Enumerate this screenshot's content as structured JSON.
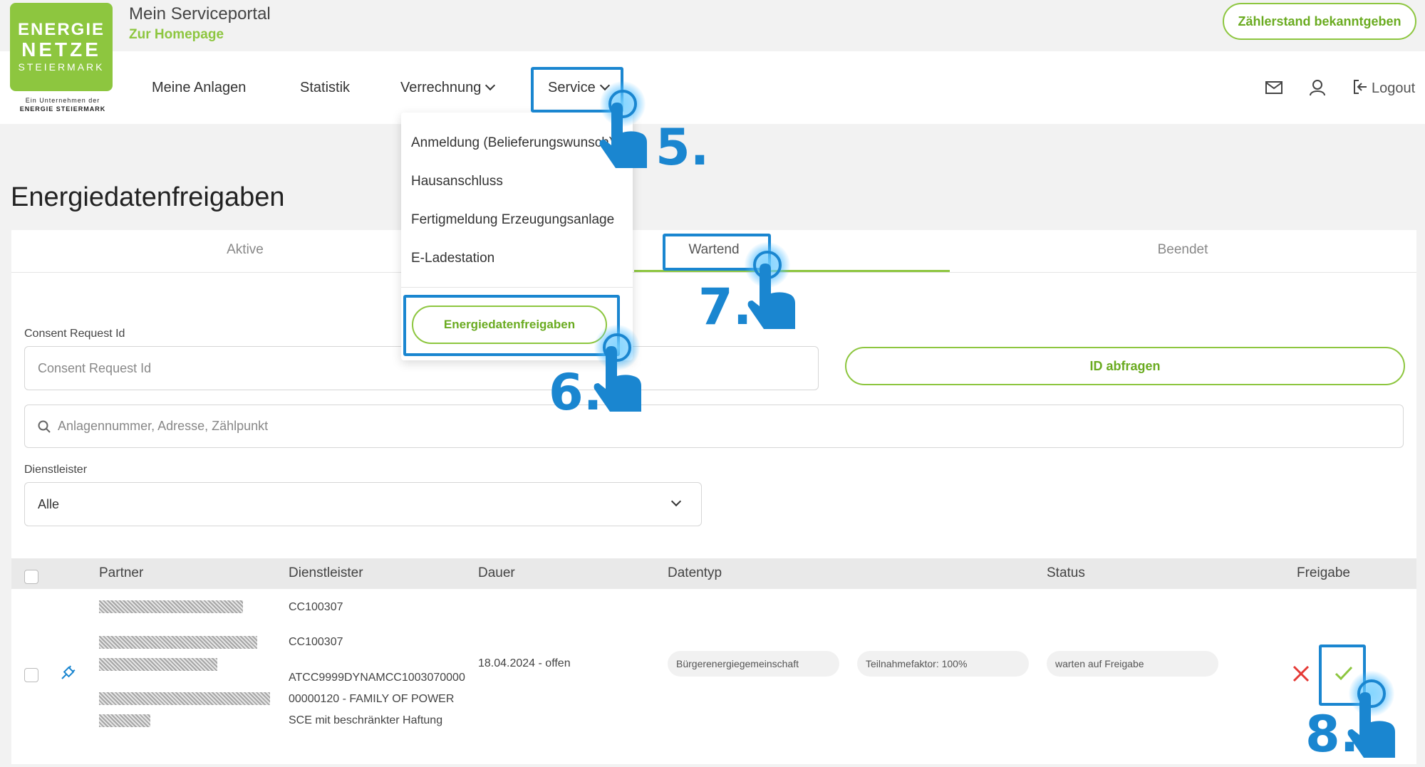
{
  "header": {
    "logo": {
      "line1": "ENERGIE",
      "line2": "NETZE",
      "line3": "STEIERMARK",
      "sub1": "Ein Unternehmen der",
      "sub2": "ENERGIE STEIERMARK"
    },
    "portal_title": "Mein Serviceportal",
    "home_link": "Zur Homepage",
    "meter_button": "Zählerstand bekanntgeben"
  },
  "nav": {
    "items": [
      {
        "label": "Meine Anlagen"
      },
      {
        "label": "Statistik"
      },
      {
        "label": "Verrechnung"
      },
      {
        "label": "Service"
      }
    ],
    "logout": "Logout",
    "icons": [
      "mail-icon",
      "user-icon",
      "logout-icon"
    ]
  },
  "service_menu": {
    "items": [
      "Anmeldung (Belieferungswunsch)",
      "Hausanschluss",
      "Fertigmeldung Erzeugungsanlage",
      "E-Ladestation"
    ],
    "highlight_button": "Energiedatenfreigaben"
  },
  "page": {
    "title": "Energiedatenfreigaben",
    "tabs": [
      "Aktive",
      "Wartend",
      "Beendet"
    ],
    "active_tab": "Wartend",
    "consent_label": "Consent Request Id",
    "consent_placeholder": "Consent Request Id",
    "id_button": "ID abfragen",
    "search_placeholder": "Anlagennummer, Adresse, Zählpunkt",
    "dienstleister_label": "Dienstleister",
    "dienstleister_value": "Alle"
  },
  "table": {
    "headers": [
      "Partner",
      "Dienstleister",
      "Dauer",
      "Datentyp",
      "Status",
      "Freigabe"
    ],
    "row": {
      "dienstleister_1": "CC100307",
      "dienstleister_2": "CC100307",
      "dienstleister_3a": "ATCC9999DYNAMCC1003070000",
      "dienstleister_3b": "00000120 - FAMILY OF POWER",
      "dienstleister_3c": "SCE mit beschränkter Haftung",
      "dauer": "18.04.2024 - offen",
      "datentyp": "Bürgerenergiegemeinschaft",
      "teilnahme": "Teilnahmefaktor: 100%",
      "status": "warten auf Freigabe"
    }
  },
  "annotations": {
    "step5": "5.",
    "step6": "6.",
    "step7": "7.",
    "step8": "8."
  },
  "colors": {
    "brand_green": "#8dc63f",
    "annotation_blue": "#1a86d0",
    "reject_red": "#e53935"
  }
}
